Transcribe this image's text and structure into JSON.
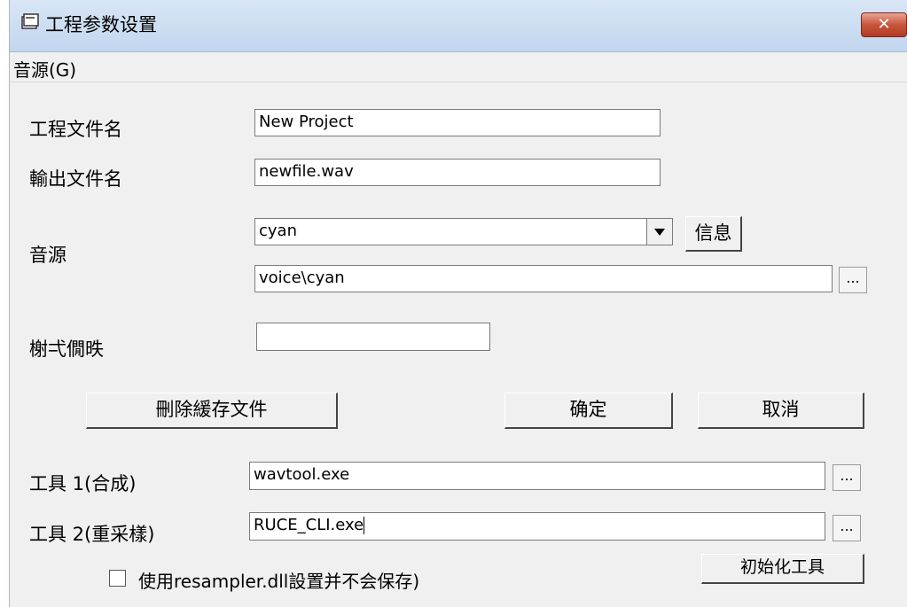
{
  "window": {
    "title": "工程参数设置",
    "close_label": "✕"
  },
  "menu": {
    "items": [
      "音源(G)"
    ]
  },
  "form": {
    "project_name_label": "工程文件名",
    "project_name_value": "New Project",
    "output_name_label": "輸出文件名",
    "output_name_value": "newfile.wav",
    "voicebank_label": "音源",
    "voicebank_selected": "cyan",
    "info_button": "信息",
    "voicebank_path": "voice\\cyan",
    "browse_label": "...",
    "flags_label": "榭弌僩昳",
    "flags_value": ""
  },
  "buttons": {
    "clear_cache": "刪除緩存文件",
    "ok": "确定",
    "cancel": "取消",
    "init_tools": "初始化工具"
  },
  "tools": {
    "tool1_label": "工具 1(合成)",
    "tool1_value": "wavtool.exe",
    "tool2_label": "工具 2(重采樣)",
    "tool2_value": "RUCE_CLI.exe",
    "resampler_checkbox_label": "使用resampler.dll設置并不会保存)",
    "resampler_checked": false
  }
}
